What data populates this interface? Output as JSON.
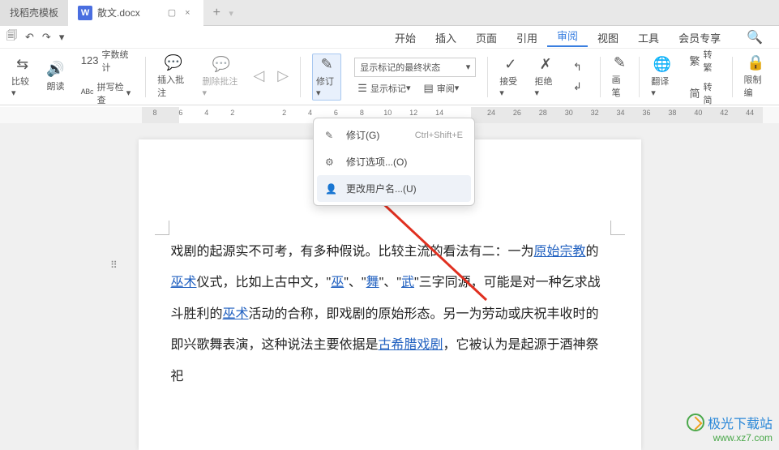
{
  "tabs": {
    "home": "找稻壳模板",
    "doc": "散文.docx",
    "plus": "+"
  },
  "menu": {
    "start": "开始",
    "insert": "插入",
    "page": "页面",
    "reference": "引用",
    "review": "审阅",
    "view": "视图",
    "tools": "工具",
    "member": "会员专享"
  },
  "ribbon": {
    "compare": "比较",
    "read": "朗读",
    "wordcount_label": "字数统计",
    "spellcheck_label": "拼写检查",
    "insert_comment": "插入批注",
    "delete_comment": "删除批注",
    "track": "修订",
    "display_state": "显示标记的最终状态",
    "show_marks": "显示标记",
    "review_pane": "审阅",
    "accept": "接受",
    "reject": "拒绝",
    "pen": "画笔",
    "translate": "翻译",
    "convert_tr": "转繁",
    "convert_si": "转简",
    "restrict": "限制编"
  },
  "dropdown": {
    "track": "修订(G)",
    "track_short": "Ctrl+Shift+E",
    "options": "修订选项...(O)",
    "username": "更改用户名...(U)"
  },
  "ruler": [
    "8",
    "6",
    "4",
    "2",
    "",
    "2",
    "4",
    "6",
    "8",
    "10",
    "12",
    "14",
    "",
    "24",
    "26",
    "28",
    "30",
    "32",
    "34",
    "36",
    "38",
    "40",
    "42",
    "44"
  ],
  "doc": {
    "p1a": "戏剧的起源实不可考，有多种假说。比较主流的看法有二：一为",
    "p1b_link1": "原始宗教",
    "p1c": "的",
    "p1b_link2": "巫术",
    "p1d": "仪式，比如上古中文，\"",
    "p1_link3": "巫",
    "p1e": "\"、\"",
    "p1_link4": "舞",
    "p1f": "\"、\"",
    "p1_link5": "武",
    "p1g": "\"三字同源，可能是对一种乞求战斗胜利的",
    "p1_link6": "巫术",
    "p1h": "活动的合称，即戏剧的原始形态。另一为劳动或庆祝丰收时的即兴歌舞表演，这种说法主要依据是",
    "p1_link7": "古希腊戏剧",
    "p1i": "，它被认为是起源于酒神祭祀"
  },
  "watermark": {
    "line1": "极光下载站",
    "line2": "www.xz7.com"
  }
}
